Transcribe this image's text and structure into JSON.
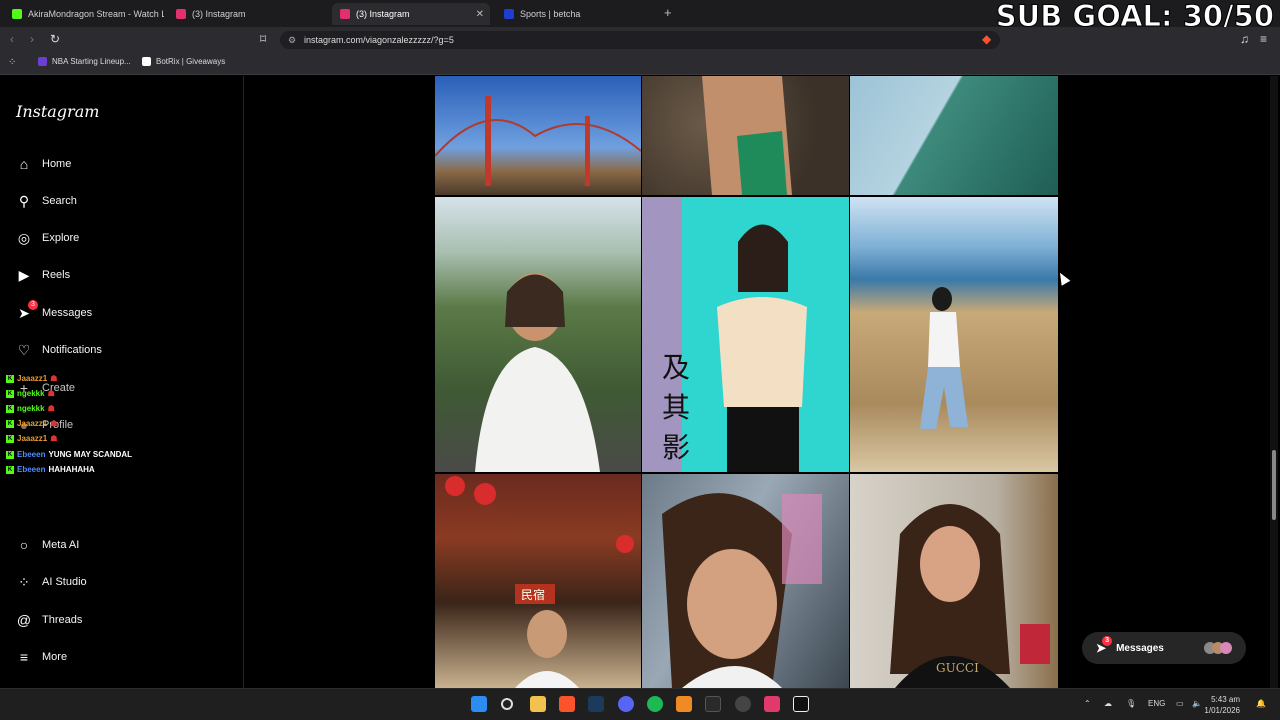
{
  "browser": {
    "tabs": [
      {
        "title": "AkiraMondragon Stream - Watch Live",
        "color": "#53fc18"
      },
      {
        "title": "(3) Instagram",
        "color": "#e1306c"
      },
      {
        "title": "(3) Instagram",
        "color": "#e1306c"
      },
      {
        "title": "Sports | betcha",
        "color": "#1c3fd1"
      }
    ],
    "new_tab": "+",
    "url": "instagram.com/viagonzalezzzzz/?g=5",
    "bookmarks": [
      "NBA Starting Lineup...",
      "BotRix | Giveaways"
    ]
  },
  "overlay": {
    "sub_goal": "SUB GOAL: 30/50"
  },
  "sidebar": {
    "logo": "Instagram",
    "items": [
      {
        "label": "Home",
        "icon": "⌂"
      },
      {
        "label": "Search",
        "icon": "⚲"
      },
      {
        "label": "Explore",
        "icon": "◎"
      },
      {
        "label": "Reels",
        "icon": "▶"
      },
      {
        "label": "Messages",
        "icon": "➤",
        "badge": "3"
      },
      {
        "label": "Notifications",
        "icon": "♡"
      },
      {
        "label": "Create",
        "icon": "+"
      },
      {
        "label": "Profile",
        "icon": "●"
      },
      {
        "label": "Meta AI",
        "icon": "○"
      },
      {
        "label": "AI Studio",
        "icon": "⁘"
      },
      {
        "label": "Threads",
        "icon": "@"
      },
      {
        "label": "More",
        "icon": "≡"
      }
    ]
  },
  "chat_overlay": [
    {
      "user": "Jaaazz1",
      "text": "",
      "color": "#e89c2f"
    },
    {
      "user": "ngekkk",
      "text": "",
      "color": "#53fc18"
    },
    {
      "user": "ngekkk",
      "text": "",
      "color": "#53fc18"
    },
    {
      "user": "Jaaazz1",
      "text": "",
      "color": "#e89c2f"
    },
    {
      "user": "Jaaazz1",
      "text": "",
      "color": "#e89c2f"
    },
    {
      "user": "Ebeeen",
      "text": "YUNG MAY SCANDAL",
      "color": "#4f8cff"
    },
    {
      "user": "Ebeeen",
      "text": "HAHAHAHA",
      "color": "#4f8cff"
    }
  ],
  "messages_pill": {
    "label": "Messages",
    "badge": "3"
  },
  "taskbar": {
    "lang": "ENG",
    "time": "5:43 am",
    "date": "1/01/2026"
  }
}
